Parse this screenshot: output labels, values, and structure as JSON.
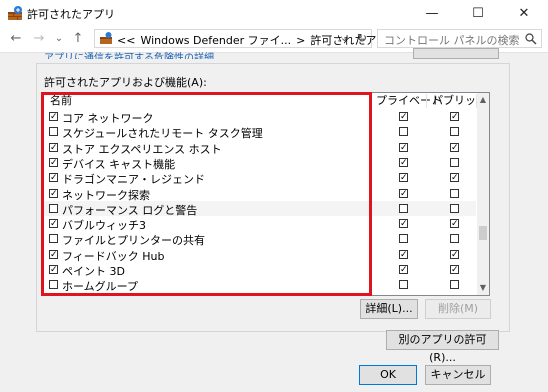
{
  "window": {
    "title": "許可されたアプリ",
    "minimize": "—",
    "maximize": "☐",
    "close": "✕"
  },
  "nav": {
    "back": "←",
    "forward": "→",
    "recent": "⌄",
    "up": "↑",
    "breadcrumb": [
      "<<",
      "Windows Defender ファイ...",
      ">",
      "許可されたアプリ"
    ],
    "dropdown": "⌄",
    "refresh": "↻",
    "search_placeholder": "コントロール パネルの検索"
  },
  "top_partial": {
    "link": "アプリに通信を許可する危険性の詳細"
  },
  "group": {
    "label": "許可されたアプリおよび機能(A):",
    "columns": {
      "name": "名前",
      "private": "プライベート",
      "public": "パブリック"
    },
    "rows": [
      {
        "name": "コア ネットワーク",
        "enabled": true,
        "private": true,
        "public": true
      },
      {
        "name": "スケジュールされたリモート タスク管理",
        "enabled": false,
        "private": false,
        "public": false
      },
      {
        "name": "ストア エクスペリエンス ホスト",
        "enabled": true,
        "private": true,
        "public": true
      },
      {
        "name": "デバイス キャスト機能",
        "enabled": true,
        "private": true,
        "public": false
      },
      {
        "name": "ドラゴンマニア・レジェンド",
        "enabled": true,
        "private": true,
        "public": true
      },
      {
        "name": "ネットワーク探索",
        "enabled": true,
        "private": true,
        "public": false
      },
      {
        "name": "パフォーマンス ログと警告",
        "enabled": false,
        "private": false,
        "public": false
      },
      {
        "name": "バブルウィッチ3",
        "enabled": true,
        "private": true,
        "public": true
      },
      {
        "name": "ファイルとプリンターの共有",
        "enabled": false,
        "private": false,
        "public": false
      },
      {
        "name": "フィードバック Hub",
        "enabled": true,
        "private": true,
        "public": true
      },
      {
        "name": "ペイント 3D",
        "enabled": true,
        "private": true,
        "public": true
      },
      {
        "name": "ホームグループ",
        "enabled": false,
        "private": false,
        "public": false
      }
    ]
  },
  "buttons": {
    "details": "詳細(L)...",
    "remove": "削除(M)",
    "allow_other": "別のアプリの許可(R)...",
    "ok": "OK",
    "cancel": "キャンセル"
  },
  "colors": {
    "highlight_box": "#e0141e",
    "link": "#1a5fb4"
  }
}
